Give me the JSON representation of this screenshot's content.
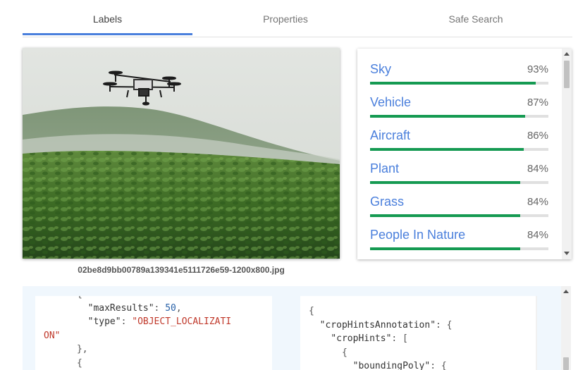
{
  "tabs": [
    {
      "label": "Labels",
      "active": true
    },
    {
      "label": "Properties",
      "active": false
    },
    {
      "label": "Safe Search",
      "active": false
    }
  ],
  "image": {
    "filename": "02be8d9bb00789a139341e5111726e59-1200x800.jpg",
    "description_icon": "drone-over-field-photo"
  },
  "labels": [
    {
      "name": "Sky",
      "score": "93%",
      "fraction": 0.93
    },
    {
      "name": "Vehicle",
      "score": "87%",
      "fraction": 0.87
    },
    {
      "name": "Aircraft",
      "score": "86%",
      "fraction": 0.86
    },
    {
      "name": "Plant",
      "score": "84%",
      "fraction": 0.84
    },
    {
      "name": "Grass",
      "score": "84%",
      "fraction": 0.84
    },
    {
      "name": "People In Nature",
      "score": "84%",
      "fraction": 0.84
    }
  ],
  "colors": {
    "accent": "#4a7fdc",
    "bar": "#159a52",
    "json_string": "#c0392b",
    "json_number": "#2962a8"
  },
  "json_left": {
    "line0": "      {",
    "key_max": "\"maxResults\"",
    "val_max": "50",
    "key_type": "\"type\"",
    "val_type_a": "\"OBJECT_LOCALIZATI",
    "val_type_b": "ON\"",
    "close": "      },",
    "open": "      {"
  },
  "json_right": {
    "line0": "{",
    "key_crop": "\"cropHintsAnnotation\"",
    "key_hints": "\"cropHints\"",
    "open_obj": "{",
    "key_poly": "\"boundingPoly\""
  }
}
